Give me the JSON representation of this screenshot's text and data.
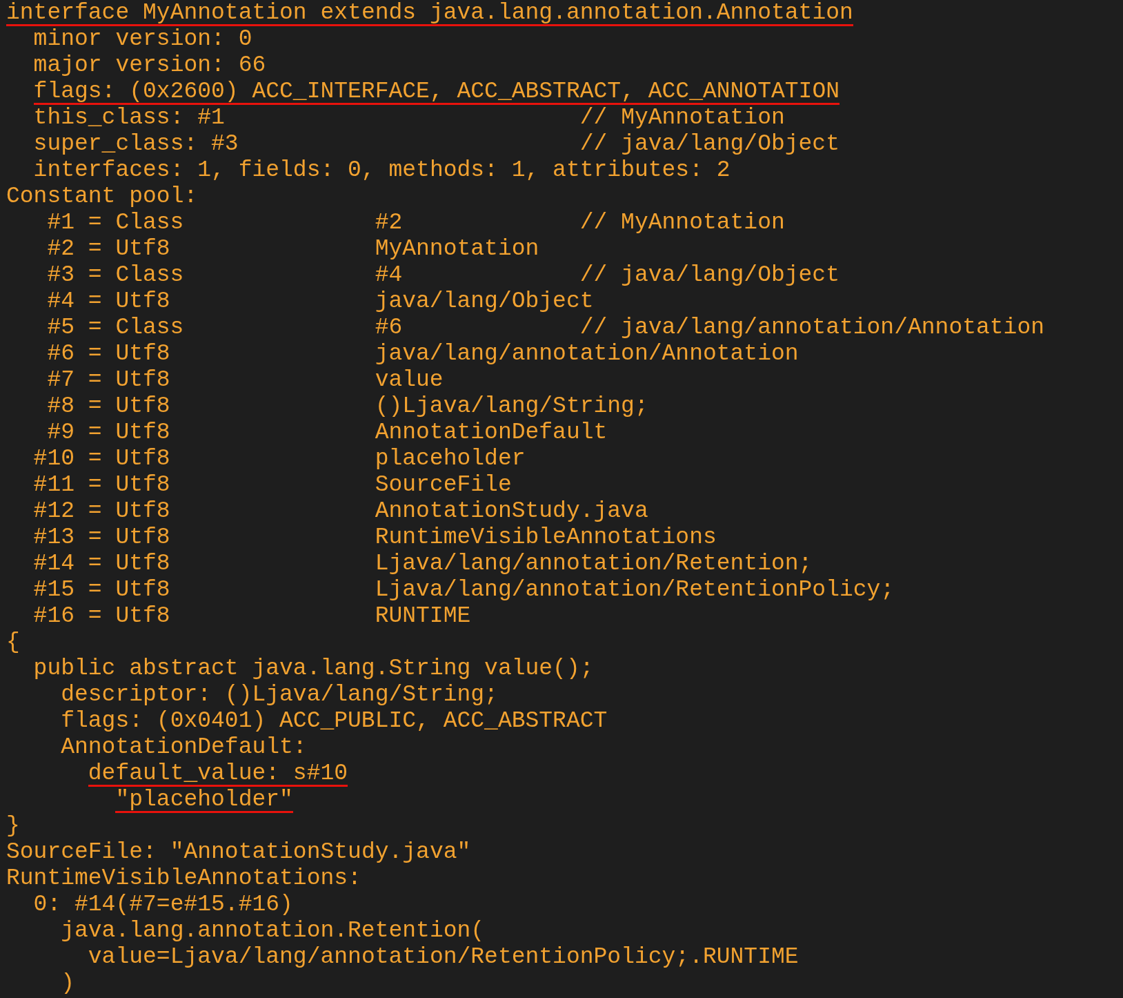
{
  "header": {
    "text": "interface MyAnnotation extends java.lang.annotation.Annotation",
    "underlined": true,
    "children": [
      {
        "text": "minor version: 0",
        "underlined": false
      },
      {
        "text": "major version: 66",
        "underlined": false
      },
      {
        "text": "flags: (0x2600) ACC_INTERFACE, ACC_ABSTRACT, ACC_ANNOTATION",
        "underlined": true
      },
      {
        "text": "this_class: #1",
        "comment": "// MyAnnotation",
        "underlined": false
      },
      {
        "text": "super_class: #3",
        "comment": "// java/lang/Object",
        "underlined": false
      },
      {
        "text": "interfaces: 1, fields: 0, methods: 1, attributes: 2",
        "underlined": false
      }
    ]
  },
  "constant_pool": {
    "title": "Constant pool:",
    "entries": [
      {
        "index": "#1",
        "equals": "=",
        "type": "Class",
        "value": "#2",
        "comment": "// MyAnnotation"
      },
      {
        "index": "#2",
        "equals": "=",
        "type": "Utf8",
        "value": "MyAnnotation"
      },
      {
        "index": "#3",
        "equals": "=",
        "type": "Class",
        "value": "#4",
        "comment": "// java/lang/Object"
      },
      {
        "index": "#4",
        "equals": "=",
        "type": "Utf8",
        "value": "java/lang/Object"
      },
      {
        "index": "#5",
        "equals": "=",
        "type": "Class",
        "value": "#6",
        "comment": "// java/lang/annotation/Annotation"
      },
      {
        "index": "#6",
        "equals": "=",
        "type": "Utf8",
        "value": "java/lang/annotation/Annotation"
      },
      {
        "index": "#7",
        "equals": "=",
        "type": "Utf8",
        "value": "value"
      },
      {
        "index": "#8",
        "equals": "=",
        "type": "Utf8",
        "value": "()Ljava/lang/String;"
      },
      {
        "index": "#9",
        "equals": "=",
        "type": "Utf8",
        "value": "AnnotationDefault"
      },
      {
        "index": "#10",
        "equals": "=",
        "type": "Utf8",
        "value": "placeholder"
      },
      {
        "index": "#11",
        "equals": "=",
        "type": "Utf8",
        "value": "SourceFile"
      },
      {
        "index": "#12",
        "equals": "=",
        "type": "Utf8",
        "value": "AnnotationStudy.java"
      },
      {
        "index": "#13",
        "equals": "=",
        "type": "Utf8",
        "value": "RuntimeVisibleAnnotations"
      },
      {
        "index": "#14",
        "equals": "=",
        "type": "Utf8",
        "value": "Ljava/lang/annotation/Retention;"
      },
      {
        "index": "#15",
        "equals": "=",
        "type": "Utf8",
        "value": "Ljava/lang/annotation/RetentionPolicy;"
      },
      {
        "index": "#16",
        "equals": "=",
        "type": "Utf8",
        "value": "RUNTIME"
      }
    ]
  },
  "body": [
    {
      "text": "{",
      "underlined": false,
      "children": [
        {
          "text": "public abstract java.lang.String value();",
          "underlined": false,
          "children": [
            {
              "text": "descriptor: ()Ljava/lang/String;",
              "underlined": false
            },
            {
              "text": "flags: (0x0401) ACC_PUBLIC, ACC_ABSTRACT",
              "underlined": false
            },
            {
              "text": "AnnotationDefault:",
              "underlined": false,
              "children": [
                {
                  "text": "default_value: s#10",
                  "underlined": true,
                  "children": [
                    {
                      "text": "\"placeholder\"",
                      "underlined": true
                    }
                  ]
                }
              ]
            }
          ]
        }
      ]
    },
    {
      "text": "}",
      "underlined": false
    },
    {
      "text": "SourceFile: \"AnnotationStudy.java\"",
      "underlined": false
    },
    {
      "text": "RuntimeVisibleAnnotations:",
      "underlined": false,
      "children": [
        {
          "text": "0: #14(#7=e#15.#16)",
          "underlined": false,
          "children": [
            {
              "text": "java.lang.annotation.Retention(",
              "underlined": false,
              "children": [
                {
                  "text": "value=Ljava/lang/annotation/RetentionPolicy;.RUNTIME",
                  "underlined": false
                }
              ]
            },
            {
              "text": ")",
              "underlined": false
            }
          ]
        }
      ]
    }
  ]
}
